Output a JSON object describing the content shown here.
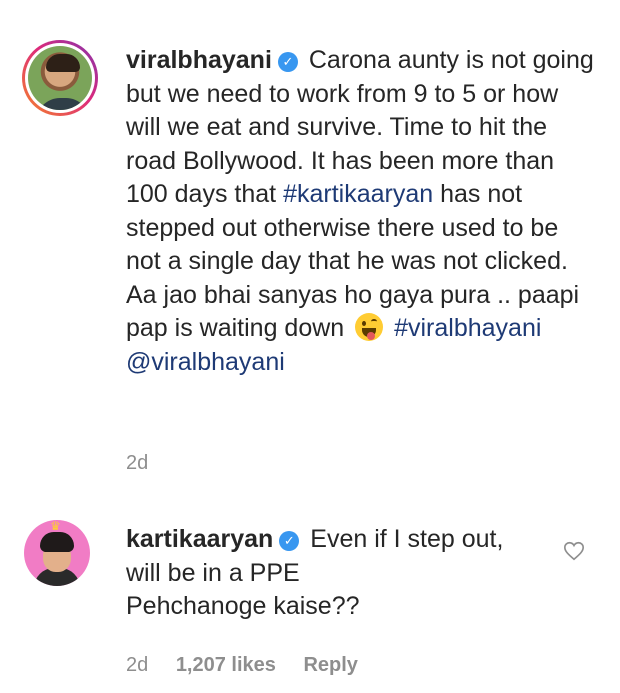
{
  "comments": [
    {
      "username": "viralbhayani",
      "text_parts": {
        "p1": "Carona aunty is not going but we need to work from 9 to 5 or how will we eat and survive. Time to hit the road Bollywood. It has been more than 100 days that ",
        "tag1": "#kartikaaryan",
        "p2": " has not stepped out otherwise there used to be not a single day that he was not clicked. Aa jao bhai sanyas ho gaya pura .. paapi pap is waiting down ",
        "tag2": "#viralbhayani",
        "tag3": "@viralbhayani"
      },
      "age": "2d"
    },
    {
      "username": "kartikaaryan",
      "line1": "Even if I step out,",
      "line2": "will be in a PPE",
      "line3": "Pehchanoge kaise??",
      "age": "2d",
      "likes": "1,207 likes",
      "reply": "Reply"
    }
  ],
  "icons": {
    "verified": "verified-badge-icon",
    "emoji": "zany-face-emoji",
    "heart": "heart-outline-icon"
  },
  "colors": {
    "hashtag": "#1e3a75",
    "verified": "#3897f0",
    "meta": "#8e8e8e"
  }
}
